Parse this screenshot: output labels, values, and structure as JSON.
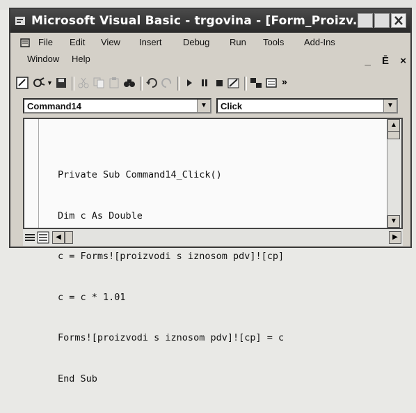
{
  "window": {
    "title": "Microsoft Visual Basic - trgovina - [Form_Proizv..."
  },
  "menu": {
    "items": [
      "File",
      "Edit",
      "View",
      "Insert",
      "Debug",
      "Run",
      "Tools",
      "Add-Ins",
      "Window",
      "Help"
    ]
  },
  "mdi_controls": [
    "_",
    "Ē",
    "×"
  ],
  "object_combo": {
    "value": "Command14"
  },
  "procedure_combo": {
    "value": "Click"
  },
  "code": {
    "lines": [
      "Private Sub Command14_Click()",
      "Dim c As Double",
      "c = Forms![proizvodi s iznosom pdv]![cp]",
      "c = c * 1.01",
      "Forms![proizvodi s iznosom pdv]![cp] = c",
      "End Sub"
    ]
  }
}
